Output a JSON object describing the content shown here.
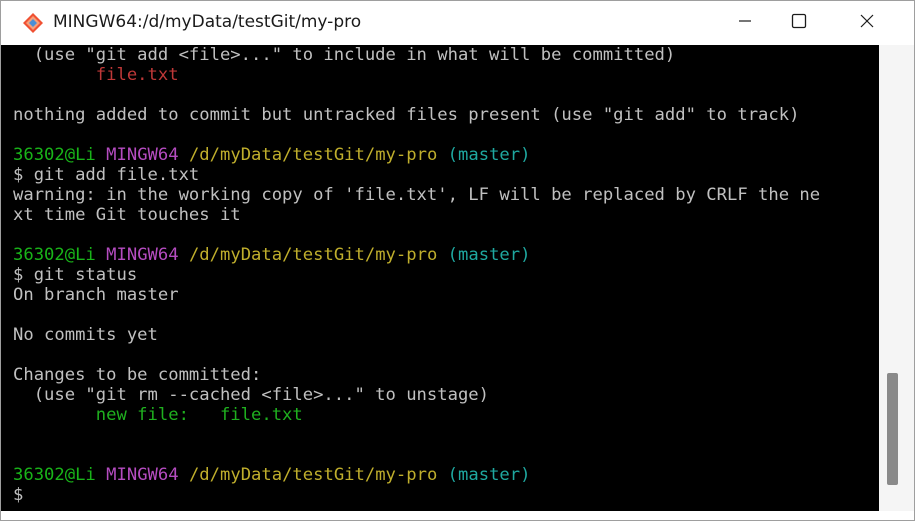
{
  "window": {
    "title": "MINGW64:/d/myData/testGit/my-pro"
  },
  "colors": {
    "terminal_bg": "#000000",
    "text_default": "#c0c0c0",
    "untracked_file": "#bf3838",
    "staged_file": "#1fb01f",
    "prompt_user": "#19b419",
    "prompt_host": "#b54cc0",
    "prompt_path": "#bfae2c",
    "prompt_branch": "#1fa8a0"
  },
  "icons": {
    "app": "git-diamond-icon",
    "minimize": "minimize-icon",
    "maximize": "maximize-icon",
    "close": "close-icon"
  },
  "terminal": {
    "line1": "  (use \"git add <file>...\" to include in what will be committed)",
    "line2": "        file.txt",
    "line4": "nothing added to commit but untracked files present (use \"git add\" to track)",
    "prompt1": {
      "user": "36302@Li",
      "host": "MINGW64",
      "path": "/d/myData/testGit/my-pro",
      "branch": "(master)"
    },
    "cmd1": "$ git add file.txt",
    "warn1": "warning: in the working copy of 'file.txt', LF will be replaced by CRLF the ne",
    "warn2": "xt time Git touches it",
    "prompt2": {
      "user": "36302@Li",
      "host": "MINGW64",
      "path": "/d/myData/testGit/my-pro",
      "branch": "(master)"
    },
    "cmd2": "$ git status",
    "branch_line": "On branch master",
    "no_commits": "No commits yet",
    "changes_header": "Changes to be committed:",
    "unstage_hint": "  (use \"git rm --cached <file>...\" to unstage)",
    "new_file": "        new file:   file.txt",
    "prompt3": {
      "user": "36302@Li",
      "host": "MINGW64",
      "path": "/d/myData/testGit/my-pro",
      "branch": "(master)"
    },
    "cursor_prompt": "$"
  }
}
